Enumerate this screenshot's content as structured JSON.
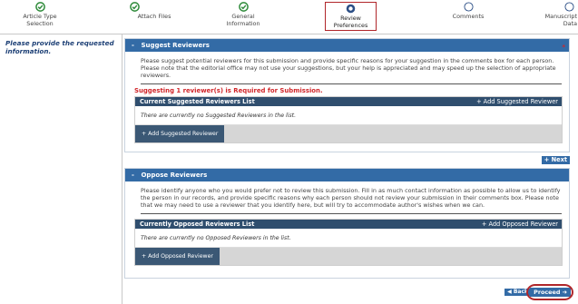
{
  "steps": [
    {
      "label_line1": "Article Type",
      "label_line2": "Selection",
      "state": "done"
    },
    {
      "label_line1": "Attach Files",
      "label_line2": "",
      "state": "done"
    },
    {
      "label_line1": "General",
      "label_line2": "Information",
      "state": "done"
    },
    {
      "label_line1": "Review",
      "label_line2": "Preferences",
      "state": "current"
    },
    {
      "label_line1": "Comments",
      "label_line2": "",
      "state": "todo"
    },
    {
      "label_line1": "Manuscript",
      "label_line2": "Data",
      "state": "todo"
    }
  ],
  "prompt": "Please provide the requested information.",
  "suggest": {
    "header": "Suggest Reviewers",
    "toggle": "-",
    "required_star": "*",
    "instructions": "Please suggest potential reviewers for this submission and provide specific reasons for your suggestion in the comments box for each person. Please note that the editorial office may not use your suggestions, but your help is appreciated and may speed up the selection of appropriate reviewers.",
    "requirement": "Suggesting 1 reviewer(s) is Required for Submission.",
    "list_title": "Current Suggested Reviewers List",
    "list_add": "+ Add Suggested Reviewer",
    "empty": "There are currently no Suggested Reviewers in the list.",
    "add_button": "+ Add Suggested Reviewer"
  },
  "next_button": "+ Next",
  "oppose": {
    "header": "Oppose Reviewers",
    "toggle": "-",
    "instructions": "Please identify anyone who you would prefer not to review this submission. Fill in as much contact information as possible to allow us to identify the person in our records, and provide specific reasons why each person should not review your submission in their comments box. Please note that we may need to use a reviewer that you identify here, but will try to accommodate author's wishes when we can.",
    "list_title": "Currently Opposed Reviewers List",
    "list_add": "+ Add Opposed Reviewer",
    "empty": "There are currently no Opposed Reviewers in the list.",
    "add_button": "+ Add Opposed Reviewer"
  },
  "back_button": "Back",
  "proceed_button": "Proceed",
  "colors": {
    "accent": "#336ba6",
    "dark_header": "#2f4e6e",
    "done_green": "#2e8b3a",
    "required_red": "#d0262a",
    "highlight": "#b0262a"
  }
}
